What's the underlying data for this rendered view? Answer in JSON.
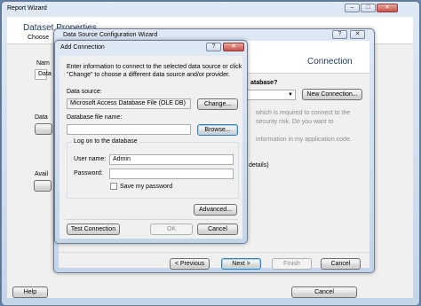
{
  "report_wizard": {
    "title": "Report Wizard",
    "page_heading": "Dataset Properties",
    "choose_label": "Choose",
    "name_label": "Nam",
    "data_label": "Data",
    "data_label2": "Data",
    "available_label": "Avail",
    "help_button": "Help",
    "cancel_button": "Cancel"
  },
  "ds_wizard": {
    "title": "Data Source Configuration Wizard",
    "heading_fragment": "Connection",
    "question": "atabase?",
    "new_connection_button": "New Connection...",
    "info_line1": "which is required to connect to the",
    "info_line2": "security risk. Do you want to",
    "info_line3": "information in my application code.",
    "details_label": "details)",
    "previous_button": "< Previous",
    "next_button": "Next >",
    "finish_button": "Finish",
    "cancel_button": "Cancel"
  },
  "add_connection": {
    "title": "Add Connection",
    "help_glyph": "?",
    "close_glyph": "✕",
    "intro_line1": "Enter information to connect to the selected data source or click",
    "intro_line2": "\"Change\" to choose a different data source and/or provider.",
    "data_source_label": "Data source:",
    "data_source_value": "Microsoft Access Database File (OLE DB)",
    "change_button": "Change...",
    "db_file_label": "Database file name:",
    "db_file_value": "",
    "browse_button": "Browse...",
    "logon_heading": "Log on to the database",
    "username_label": "User name:",
    "username_value": "Admin",
    "password_label": "Password:",
    "password_value": "",
    "save_password_label": "Save my password",
    "advanced_button": "Advanced...",
    "test_button": "Test Connection",
    "ok_button": "OK",
    "cancel_button": "Cancel"
  }
}
